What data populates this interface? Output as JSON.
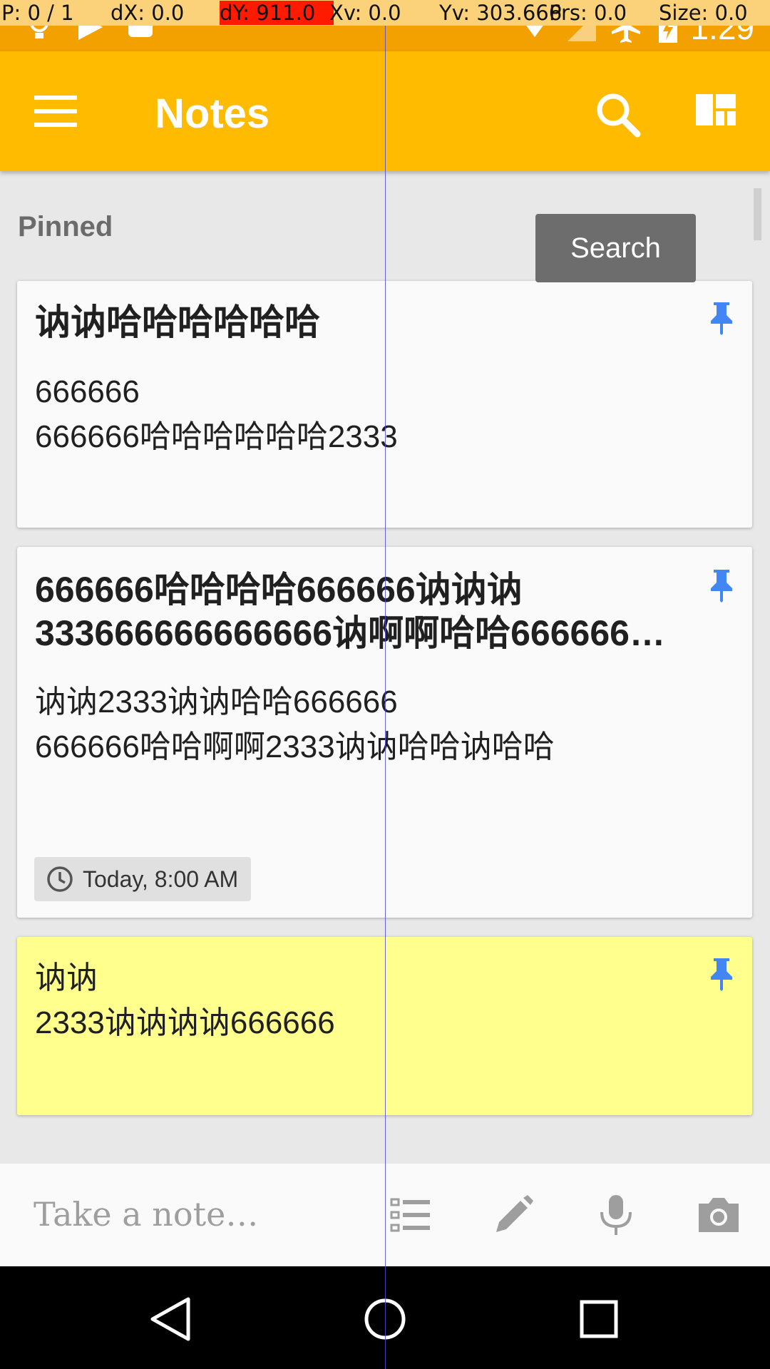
{
  "debug": {
    "p": "P: 0 / 1",
    "dx": "dX: 0.0",
    "dy": "dY: 911.0",
    "xv": "Xv: 0.0",
    "yv": "Yv: 303.666",
    "prs": "Prs: 0.0",
    "size": "Size: 0.0"
  },
  "status": {
    "time": "1:29"
  },
  "appbar": {
    "title": "Notes"
  },
  "section": {
    "label": "Pinned"
  },
  "tooltip": {
    "text": "Search"
  },
  "notes": [
    {
      "title": "讷讷哈哈哈哈哈哈",
      "body_line1": "666666",
      "body_line2": "666666哈哈哈哈哈哈2333",
      "color": "#fafafa"
    },
    {
      "title_line1": "666666哈哈哈哈666666讷讷讷",
      "title_line2": "333666666666666讷啊啊哈哈666666…",
      "body_line1": "讷讷2333讷讷哈哈666666",
      "body_line2": "666666哈哈啊啊2333讷讷哈哈讷哈哈",
      "reminder": "Today, 8:00 AM",
      "color": "#fafafa"
    },
    {
      "body_line1": "讷讷",
      "body_line2": "2333讷讷讷讷666666",
      "color": "#ffff8d"
    }
  ],
  "bottombar": {
    "placeholder": "Take a note…"
  },
  "colors": {
    "accent": "#ffbb00",
    "status": "#f3a100",
    "pin": "#4285f4"
  },
  "icons": [
    "menu-icon",
    "search-icon",
    "layout-icon",
    "pin-icon",
    "clock-icon",
    "list-icon",
    "pen-icon",
    "mic-icon",
    "camera-icon",
    "back-icon",
    "home-icon",
    "recents-icon"
  ]
}
